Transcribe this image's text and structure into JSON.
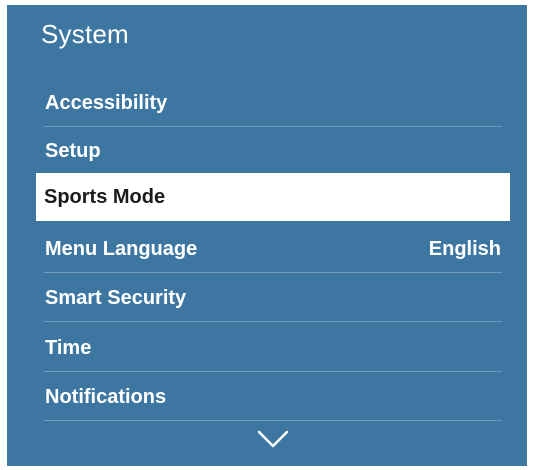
{
  "header": {
    "title": "System"
  },
  "menu": {
    "items": [
      {
        "label": "Accessibility",
        "value": ""
      },
      {
        "label": "Setup",
        "value": ""
      },
      {
        "label": "Sports Mode",
        "value": "",
        "selected": true
      },
      {
        "label": "Menu Language",
        "value": "English"
      },
      {
        "label": "Smart Security",
        "value": ""
      },
      {
        "label": "Time",
        "value": ""
      },
      {
        "label": "Notifications",
        "value": ""
      }
    ]
  },
  "icons": {
    "scroll_down": "chevron-down-icon"
  },
  "colors": {
    "panel_background": "#3e76a2",
    "selected_background": "#ffffff",
    "selected_text": "#1b1b1b",
    "text": "#ffffff"
  }
}
